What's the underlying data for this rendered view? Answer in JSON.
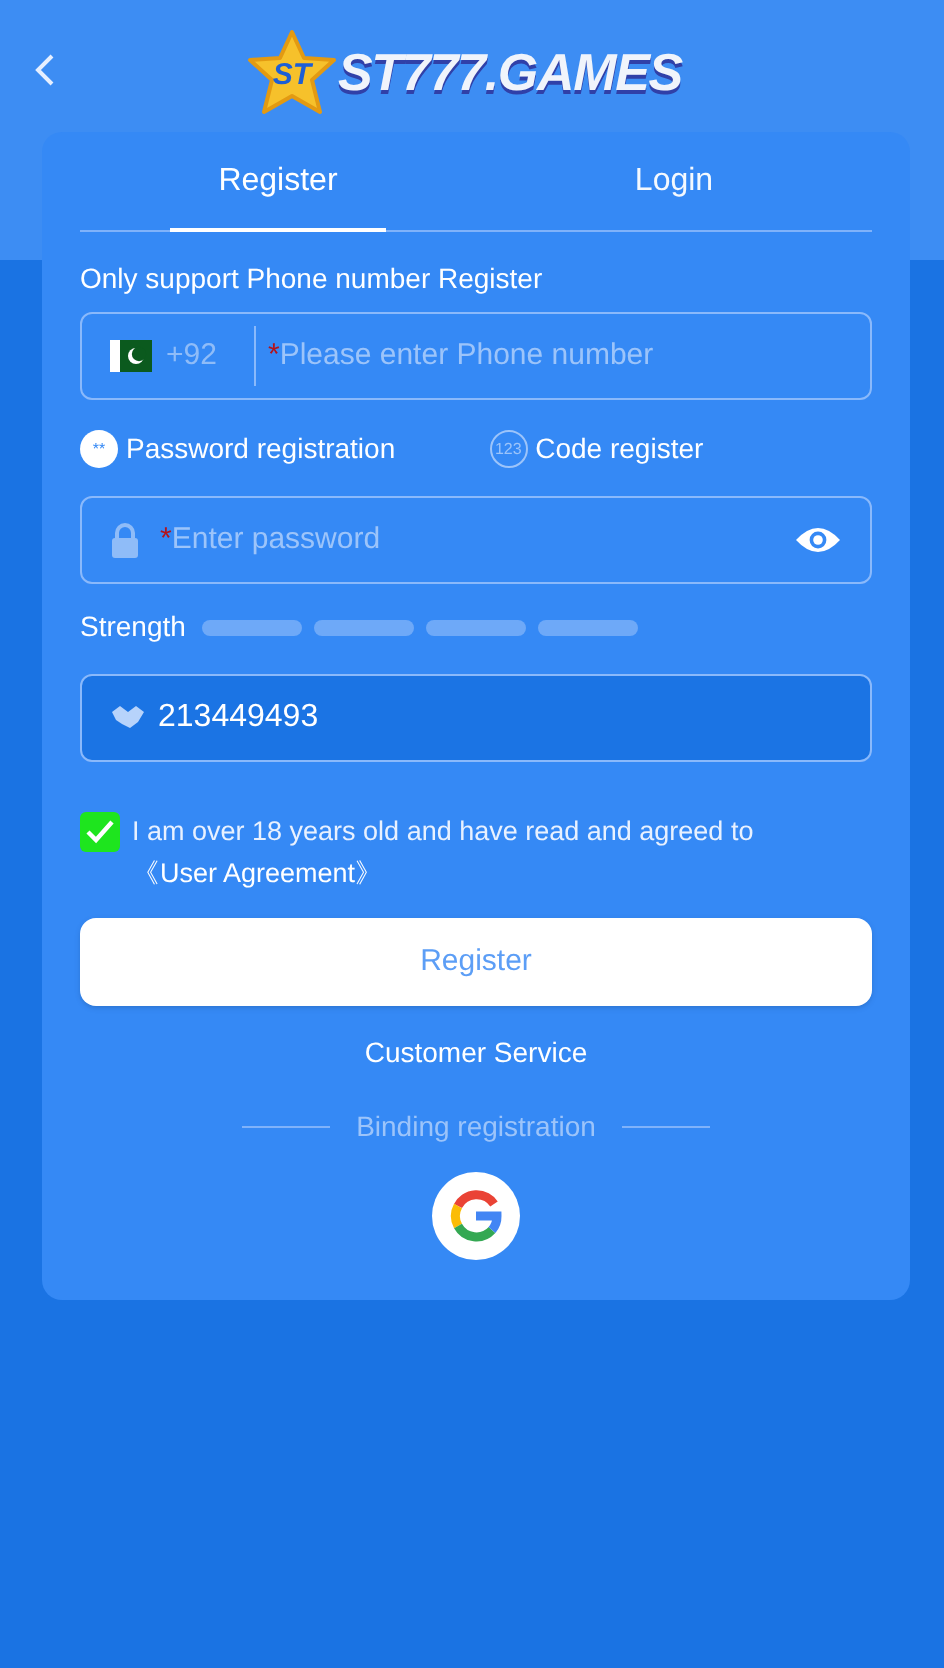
{
  "header": {
    "logo_badge": "ST",
    "logo_text": "ST777.GAMES"
  },
  "tabs": [
    {
      "label": "Register",
      "selected": true
    },
    {
      "label": "Login",
      "selected": false
    }
  ],
  "phone": {
    "label": "Only support Phone number Register",
    "country_code": "+92",
    "required_mark": "*",
    "placeholder": "Please enter Phone number"
  },
  "modes": [
    {
      "label": "Password registration",
      "icon_text": "**",
      "selected": true
    },
    {
      "label": "Code register",
      "icon_text": "123",
      "selected": false
    }
  ],
  "password": {
    "required_mark": "*",
    "placeholder": "Enter password"
  },
  "strength": {
    "label": "Strength"
  },
  "invite": {
    "value": "213449493"
  },
  "agreement": {
    "checked": true,
    "text": "I am over 18 years old and have read and agreed to ",
    "link": "《User Agreement》"
  },
  "register_button": "Register",
  "customer_service": "Customer Service",
  "binding_label": "Binding registration"
}
